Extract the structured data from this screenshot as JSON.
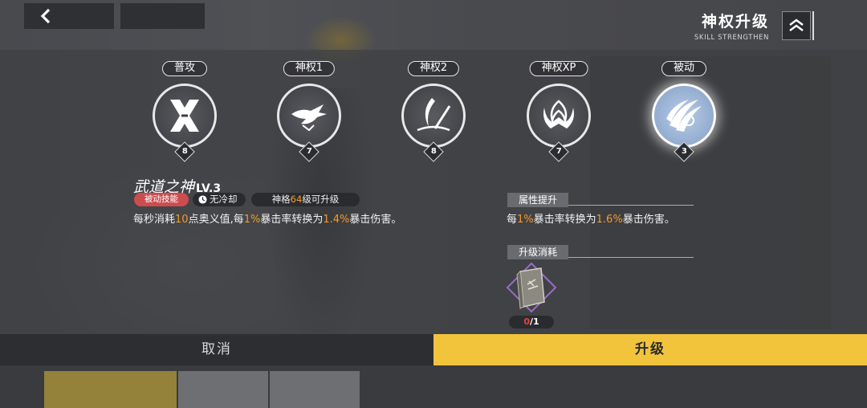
{
  "header": {
    "title": "神权升级",
    "subtitle": "SKILL STRENGTHEN",
    "back_icon": "chevron-left-icon",
    "rank_icon": "double-chevron-up-icon"
  },
  "skills": [
    {
      "tag": "普攻",
      "level": "8",
      "icon": "crossed-swords-x-icon"
    },
    {
      "tag": "神权1",
      "level": "7",
      "icon": "dragon-slash-icon"
    },
    {
      "tag": "神权2",
      "level": "8",
      "icon": "sword-crescent-icon"
    },
    {
      "tag": "神权XP",
      "level": "7",
      "icon": "crown-flame-icon"
    },
    {
      "tag": "被动",
      "level": "3",
      "icon": "claw-slash-icon",
      "selected": true
    }
  ],
  "detail": {
    "name": "武道之神",
    "level_text": "LV.3",
    "type_badge": "被动技能",
    "cooldown": "无冷却",
    "req_prefix": "神格",
    "req_level": "64",
    "req_suffix": "级可升级",
    "desc_parts": [
      "每秒消耗",
      "10",
      "点奥义值,每",
      "1%",
      "暴击率转换为",
      "1.4%",
      "暴击伤害。"
    ]
  },
  "upgrade": {
    "attr_title": "属性提升",
    "attr_parts": [
      "每",
      "1%",
      "暴击率转换为",
      "1.6%",
      "暴击伤害。"
    ],
    "cost_title": "升级消耗",
    "material_icon": "skill-book-icon",
    "owned": "0",
    "required": "/1"
  },
  "buttons": {
    "cancel": "取消",
    "upgrade": "升级"
  },
  "colors": {
    "highlight": "#f39a2c",
    "upgrade_button": "#f2c43c",
    "passive_badge": "#cc4c4f",
    "owned_insufficient": "#e6423e"
  }
}
